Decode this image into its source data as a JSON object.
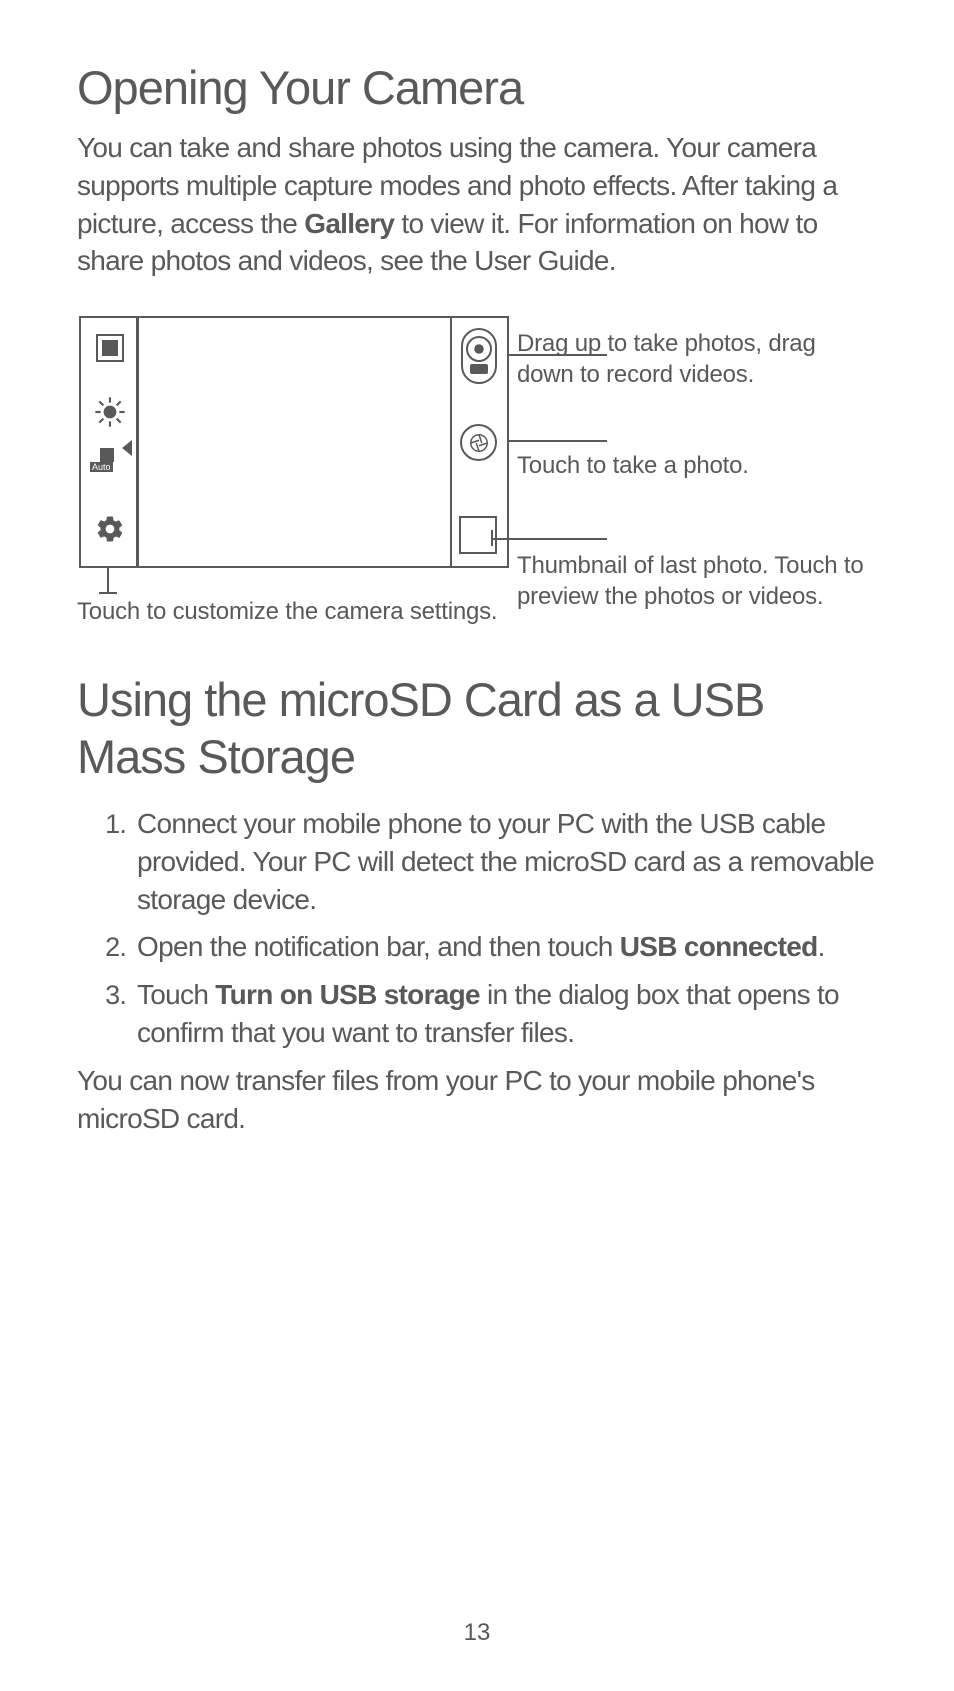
{
  "section1": {
    "title": "Opening Your Camera",
    "intro_parts": [
      "You can take and share photos using the camera. Your camera supports multiple capture modes and photo effects. After taking a picture, access the ",
      "Gallery",
      " to view it. For information on how to share photos and videos, see the User Guide."
    ],
    "diagram": {
      "label_slider": "Drag up to take photos, drag down to record videos.",
      "label_shutter": "Touch to take a photo.",
      "label_thumbnail": "Thumbnail of last photo. Touch to preview the photos or videos.",
      "label_settings": "Touch to customize the camera settings.",
      "icons": {
        "top_left": "viewfinder-rect",
        "flash": "flash-icon",
        "auto": "auto-mode-icon",
        "gear": "settings-gear",
        "slider": "capture-slider",
        "shutter": "shutter-button",
        "thumbnail": "thumbnail-preview"
      }
    }
  },
  "section2": {
    "title": "Using the microSD Card as a USB Mass Storage",
    "steps": [
      {
        "parts": [
          "Connect your mobile phone to your PC with the USB cable provided. Your PC will detect the microSD card as a removable storage device."
        ]
      },
      {
        "parts": [
          "Open the notification bar, and then touch ",
          {
            "b": "USB connected"
          },
          "."
        ]
      },
      {
        "parts": [
          "Touch ",
          {
            "b": "Turn on USB storage"
          },
          " in the dialog box that opens to confirm that you want to transfer files."
        ]
      }
    ],
    "after": "You can now transfer files from your PC to your mobile phone's microSD card."
  },
  "page_number": "13"
}
